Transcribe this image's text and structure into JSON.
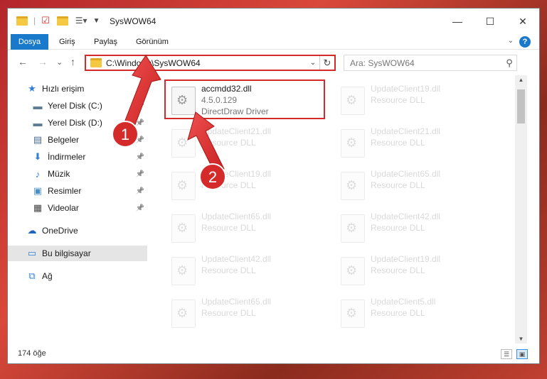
{
  "window": {
    "title": "SysWOW64",
    "controls": {
      "minimize": "—",
      "maximize": "☐",
      "close": "✕"
    }
  },
  "ribbon": {
    "tabs": [
      {
        "label": "Dosya",
        "active": true
      },
      {
        "label": "Giriş"
      },
      {
        "label": "Paylaş"
      },
      {
        "label": "Görünüm"
      }
    ],
    "help": "?"
  },
  "nav": {
    "back": "←",
    "forward": "→",
    "recent": "⌄",
    "up": "↑"
  },
  "address": {
    "path": "C:\\Windows\\SysWOW64"
  },
  "search": {
    "placeholder": "Ara: SysWOW64"
  },
  "sidebar": {
    "items": [
      {
        "label": "Hızlı erişim",
        "icon": "star-icon",
        "glyph": "★",
        "color": "#2f7fd8",
        "pinned": false
      },
      {
        "label": "Yerel Disk (C:)",
        "icon": "drive-icon",
        "glyph": "▬",
        "color": "#5d7b94",
        "pinned": true
      },
      {
        "label": "Yerel Disk (D:)",
        "icon": "drive-icon",
        "glyph": "▬",
        "color": "#5d7b94",
        "pinned": true
      },
      {
        "label": "Belgeler",
        "icon": "document-icon",
        "glyph": "▤",
        "color": "#4a6a8e",
        "pinned": true
      },
      {
        "label": "İndirmeler",
        "icon": "download-icon",
        "glyph": "⬇",
        "color": "#2f7fd8",
        "pinned": true
      },
      {
        "label": "Müzik",
        "icon": "music-icon",
        "glyph": "♪",
        "color": "#2f7fd8",
        "pinned": true
      },
      {
        "label": "Resimler",
        "icon": "picture-icon",
        "glyph": "▣",
        "color": "#4a8fc4",
        "pinned": true
      },
      {
        "label": "Videolar",
        "icon": "video-icon",
        "glyph": "▦",
        "color": "#444444",
        "pinned": true
      },
      {
        "label": "OneDrive",
        "icon": "cloud-icon",
        "glyph": "☁",
        "color": "#1e63b8",
        "pinned": false
      },
      {
        "label": "Bu bilgisayar",
        "icon": "computer-icon",
        "glyph": "▭",
        "color": "#2f7fd8",
        "pinned": false,
        "selected": true
      },
      {
        "label": "Ağ",
        "icon": "network-icon",
        "glyph": "⧉",
        "color": "#2f7fd8",
        "pinned": false
      }
    ]
  },
  "files": {
    "highlighted": {
      "name": "accmdd32.dll",
      "version": "4.5.0.129",
      "description": "DirectDraw Driver"
    },
    "right_column": [
      {
        "name": "UpdateClient19.dll",
        "description": "Resource DLL"
      },
      {
        "name": "UpdateClient21.dll",
        "description": "Resource DLL"
      },
      {
        "name": "UpdateClient65.dll",
        "description": "Resource DLL"
      },
      {
        "name": "UpdateClient42.dll",
        "description": "Resource DLL"
      },
      {
        "name": "UpdateClient19.dll",
        "description": "Resource DLL"
      },
      {
        "name": "UpdateClient5.dll",
        "description": "Resource DLL"
      }
    ],
    "left_column": [
      {
        "name": "UpdateClient21.dll",
        "description": "Resource DLL"
      },
      {
        "name": "UpdateClient19.dll",
        "description": "Resource DLL"
      },
      {
        "name": "UpdateClient65.dll",
        "description": "Resource DLL"
      },
      {
        "name": "UpdateClient42.dll",
        "description": "Resource DLL"
      },
      {
        "name": "UpdateClient65.dll",
        "description": "Resource DLL"
      }
    ]
  },
  "status": {
    "count": "174 öğe"
  },
  "annotations": {
    "step1": "1",
    "step2": "2",
    "color": "#d42a2a"
  }
}
